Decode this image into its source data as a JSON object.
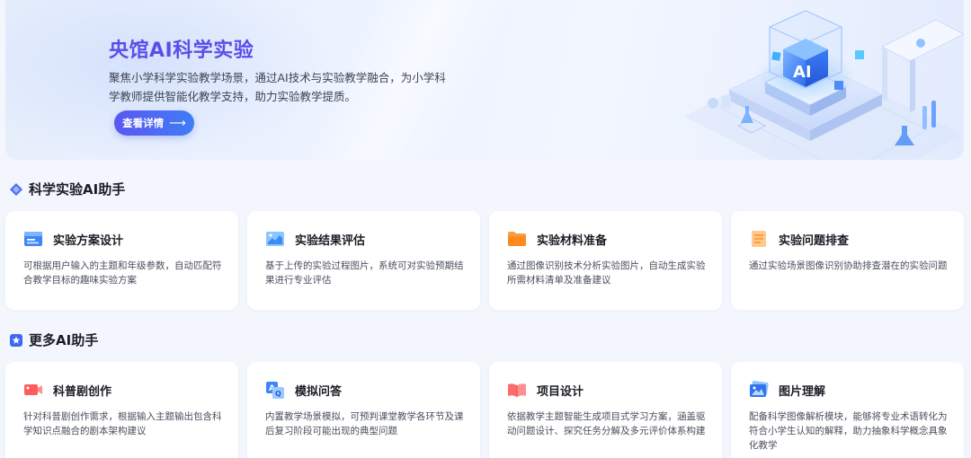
{
  "banner": {
    "title": "央馆AI科学实验",
    "description": "聚焦小学科学实验教学场景，通过AI技术与实验教学融合，为小学科学教师提供智能化教学支持，助力实验教学提质。",
    "button_label": "查看详情",
    "button_arrow": "⟶",
    "illustration_text": "AI",
    "accent_color": "#5b4ee8"
  },
  "section_science": {
    "title": "科学实验AI助手",
    "cards": [
      {
        "icon": "plan-document-icon",
        "title": "实验方案设计",
        "desc": "可根据用户输入的主题和年级参数，自动匹配符合教学目标的趣味实验方案"
      },
      {
        "icon": "result-chart-icon",
        "title": "实验结果评估",
        "desc": "基于上传的实验过程图片，系统可对实验预期结果进行专业评估"
      },
      {
        "icon": "folder-icon",
        "title": "实验材料准备",
        "desc": "通过图像识别技术分析实验图片，自动生成实验所需材料清单及准备建议"
      },
      {
        "icon": "checklist-icon",
        "title": "实验问题排查",
        "desc": "通过实验场景图像识别协助排查潜在的实验问题"
      }
    ]
  },
  "section_more": {
    "title": "更多AI助手",
    "cards": [
      {
        "icon": "video-camera-icon",
        "title": "科普剧创作",
        "desc": "针对科普剧创作需求，根据输入主题输出包含科学知识点融合的剧本架构建议"
      },
      {
        "icon": "qa-translate-icon",
        "title": "模拟问答",
        "desc": "内置教学场景模拟，可预判课堂教学各环节及课后复习阶段可能出现的典型问题"
      },
      {
        "icon": "open-book-icon",
        "title": "项目设计",
        "desc": "依据教学主题智能生成项目式学习方案，涵盖驱动问题设计、探究任务分解及多元评价体系构建"
      },
      {
        "icon": "image-understanding-icon",
        "title": "图片理解",
        "desc": "配备科学图像解析模块，能够将专业术语转化为符合小学生认知的解释，助力抽象科学概念具象化教学"
      }
    ]
  }
}
